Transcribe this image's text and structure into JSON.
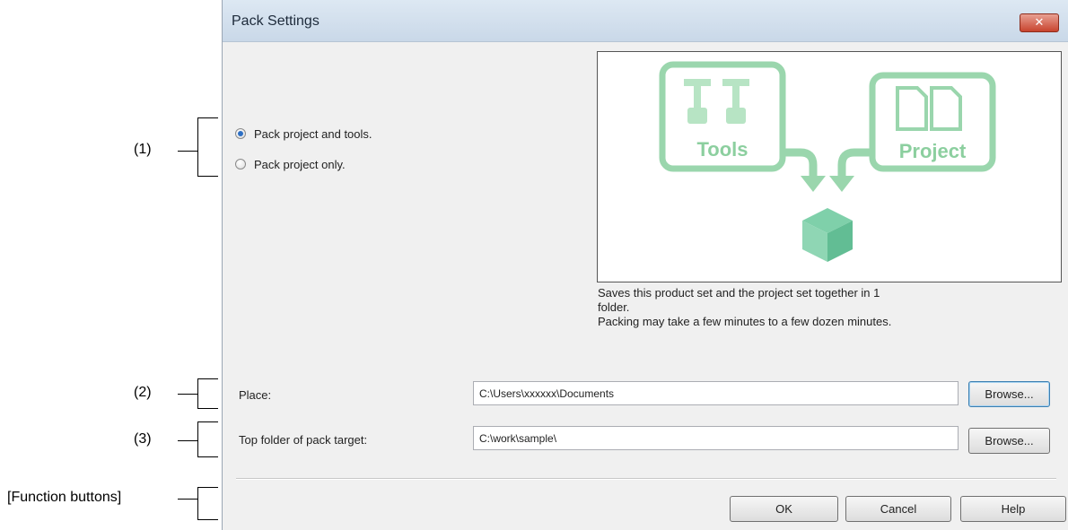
{
  "annotations": {
    "callout_1": "(1)",
    "callout_2": "(2)",
    "callout_3": "(3)",
    "callout_function": "[Function buttons]"
  },
  "dialog": {
    "title": "Pack Settings",
    "close_glyph": "✕"
  },
  "options": {
    "pack_project_and_tools": "Pack project and tools.",
    "pack_project_only": "Pack project only.",
    "selected": "pack_project_and_tools"
  },
  "illustration": {
    "tools_label": "Tools",
    "project_label": "Project",
    "description_lines": [
      "Saves this product set and the project set together in 1",
      "folder.",
      "Packing may take a few minutes to a few dozen minutes."
    ]
  },
  "place": {
    "label": "Place:",
    "value": "C:\\Users\\xxxxxx\\Documents",
    "browse_label": "Browse..."
  },
  "top_folder": {
    "label": "Top folder of pack target:",
    "value": "C:\\work\\sample\\",
    "browse_label": "Browse..."
  },
  "buttons": {
    "ok": "OK",
    "cancel": "Cancel",
    "help": "Help"
  },
  "colors": {
    "illustration_green": "#8fd3a2",
    "illustration_green_dark": "#5db583",
    "box_green": "#6cc59a",
    "close_red": "#c8442e"
  }
}
